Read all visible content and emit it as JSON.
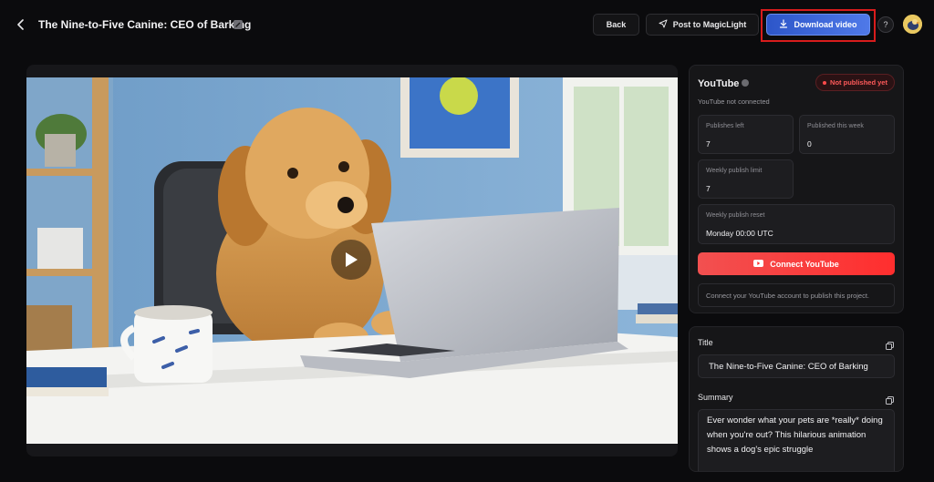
{
  "header": {
    "title": "The Nine-to-Five Canine: CEO of Barking",
    "back_label": "Back",
    "post_label": "Post to MagicLight",
    "download_label": "Download video",
    "help_label": "?",
    "icons": [
      "back-arrow-icon",
      "edit-icon",
      "send-icon",
      "download-icon",
      "help-icon"
    ]
  },
  "youtube": {
    "title": "YouTube",
    "status": "Not published yet",
    "connection_status": "YouTube not connected",
    "stats": {
      "publishes_left_label": "Publishes left",
      "publishes_left_value": "7",
      "published_week_label": "Published this week",
      "published_week_value": "0",
      "weekly_limit_label": "Weekly publish limit",
      "weekly_limit_value": "7",
      "weekly_reset_label": "Weekly publish reset",
      "weekly_reset_value": "Monday 00:00 UTC"
    },
    "connect_label": "Connect YouTube",
    "connect_note": "Connect your YouTube account to publish this project."
  },
  "metadata": {
    "title_label": "Title",
    "title_value": "The Nine-to-Five Canine: CEO of Barking",
    "summary_label": "Summary",
    "summary_value": "Ever wonder what your pets are *really* doing when you're out? This hilarious animation shows a dog's epic struggle"
  },
  "colors": {
    "accent_blue": "#3d67dc",
    "highlight_red": "#d81c1c",
    "youtube_red": "#ff2e2e",
    "status_red": "#ff5a5a"
  }
}
